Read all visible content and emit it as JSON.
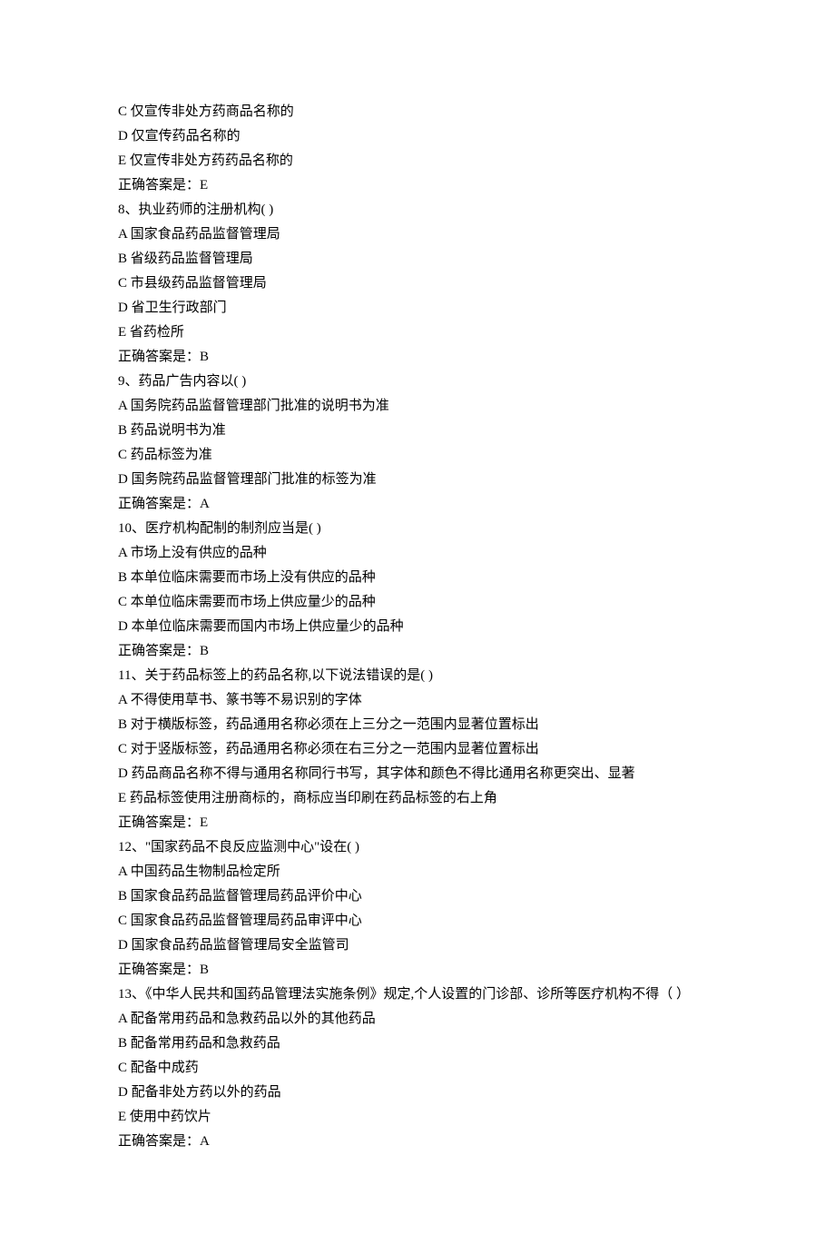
{
  "lines": [
    "C 仅宣传非处方药商品名称的",
    "D 仅宣传药品名称的",
    "E 仅宣传非处方药药品名称的",
    "正确答案是：E",
    "8、执业药师的注册机构( )",
    "A 国家食品药品监督管理局",
    "B 省级药品监督管理局",
    "C 市县级药品监督管理局",
    "D 省卫生行政部门",
    "E 省药检所",
    "正确答案是：B",
    "9、药品广告内容以( )",
    "A 国务院药品监督管理部门批准的说明书为准",
    "B 药品说明书为准",
    "C 药品标签为准",
    "D 国务院药品监督管理部门批准的标签为准",
    "正确答案是：A",
    "10、医疗机构配制的制剂应当是( )",
    "A 市场上没有供应的品种",
    "B 本单位临床需要而市场上没有供应的品种",
    "C 本单位临床需要而市场上供应量少的品种",
    "D 本单位临床需要而国内市场上供应量少的品种",
    "正确答案是：B",
    "11、关于药品标签上的药品名称,以下说法错误的是( )",
    "A 不得使用草书、篆书等不易识别的字体",
    "B 对于横版标签，药品通用名称必须在上三分之一范围内显著位置标出",
    "C 对于竖版标签，药品通用名称必须在右三分之一范围内显著位置标出",
    "D 药品商品名称不得与通用名称同行书写，其字体和颜色不得比通用名称更突出、显著",
    "E 药品标签使用注册商标的，商标应当印刷在药品标签的右上角",
    "正确答案是：E",
    "12、\"国家药品不良反应监测中心\"设在( )",
    "A 中国药品生物制品检定所",
    "B 国家食品药品监督管理局药品评价中心",
    "C 国家食品药品监督管理局药品审评中心",
    "D 国家食品药品监督管理局安全监管司",
    "正确答案是：B",
    "13、《中华人民共和国药品管理法实施条例》规定,个人设置的门诊部、诊所等医疗机构不得（ ）",
    "A 配备常用药品和急救药品以外的其他药品",
    "B 配备常用药品和急救药品",
    "C 配备中成药",
    "D 配备非处方药以外的药品",
    "E 使用中药饮片",
    "正确答案是：A"
  ]
}
